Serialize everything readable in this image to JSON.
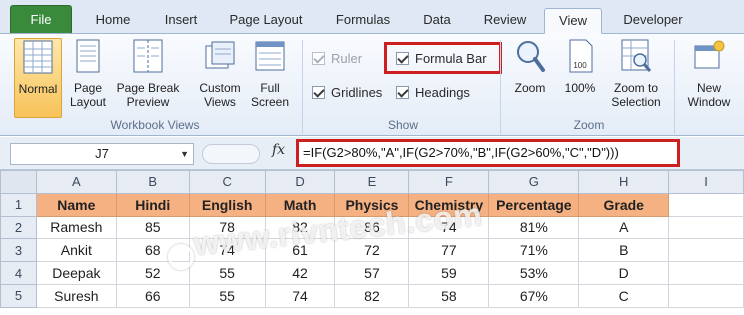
{
  "tabs": [
    "File",
    "Home",
    "Insert",
    "Page Layout",
    "Formulas",
    "Data",
    "Review",
    "View",
    "Developer"
  ],
  "active_tab": "View",
  "ribbon": {
    "workbook_views": {
      "label": "Workbook Views",
      "buttons": {
        "normal": "Normal",
        "page_layout": "Page Layout",
        "page_break": "Page Break Preview",
        "custom_views": "Custom Views",
        "full_screen": "Full Screen"
      }
    },
    "show": {
      "label": "Show",
      "ruler": "Ruler",
      "gridlines": "Gridlines",
      "formula_bar": "Formula Bar",
      "headings": "Headings",
      "ruler_checked": true,
      "gridlines_checked": true,
      "formula_bar_checked": true,
      "headings_checked": true
    },
    "zoom": {
      "label": "Zoom",
      "zoom": "Zoom",
      "hundred": "100%",
      "zoom_to_selection": "Zoom to Selection",
      "icon_text": "100"
    },
    "window": {
      "new_window": "New Window"
    }
  },
  "formula_bar": {
    "name_box": "J7",
    "fx": "fx",
    "formula": "=IF(G2>80%,\"A\",IF(G2>70%,\"B\",IF(G2>60%,\"C\",\"D\")))"
  },
  "sheet": {
    "columns": [
      "A",
      "B",
      "C",
      "D",
      "E",
      "F",
      "G",
      "H",
      "I"
    ],
    "rows": [
      "1",
      "2",
      "3",
      "4",
      "5"
    ],
    "header": [
      "Name",
      "Hindi",
      "English",
      "Math",
      "Physics",
      "Chemistry",
      "Percentage",
      "Grade"
    ],
    "data": [
      [
        "Ramesh",
        "85",
        "78",
        "82",
        "86",
        "74",
        "81%",
        "A"
      ],
      [
        "Ankit",
        "68",
        "74",
        "61",
        "72",
        "77",
        "71%",
        "B"
      ],
      [
        "Deepak",
        "52",
        "55",
        "42",
        "57",
        "59",
        "53%",
        "D"
      ],
      [
        "Suresh",
        "66",
        "55",
        "74",
        "82",
        "58",
        "67%",
        "C"
      ]
    ]
  },
  "watermark": "www.rivntech.com",
  "colors": {
    "file_tab": "#3a8a3b",
    "header_fill": "#f6b183",
    "highlight_border": "#cc1f1f",
    "selected_view": "#f8c35a"
  }
}
